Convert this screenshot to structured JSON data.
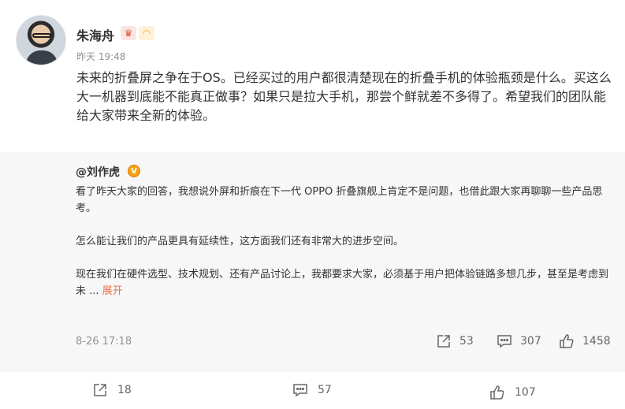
{
  "post": {
    "author": "朱海舟",
    "time": "昨天 19:48",
    "badges": [
      "crown-badge",
      "rainbow-badge"
    ],
    "content": "未来的折叠屏之争在于OS。已经买过的用户都很清楚现在的折叠手机的体验瓶颈是什么。买这么大一机器到底能不能真正做事？如果只是拉大手机，那尝个鲜就差不多得了。希望我们的团队能给大家带来全新的体验。"
  },
  "repost": {
    "author": "@刘作虎",
    "paragraphs": [
      "看了昨天大家的回答，我想说外屏和折痕在下一代 OPPO 折叠旗舰上肯定不是问题，也借此跟大家再聊聊一些产品思考。",
      "怎么能让我们的产品更具有延续性，这方面我们还有非常大的进步空间。",
      "现在我们在硬件选型、技术规划、还有产品讨论上，我都要求大家，必须基于用户把体验链路多想几步，甚至是考虑到未 ..."
    ],
    "expand_label": "展开",
    "time": "8-26 17:18",
    "forward_count": "53",
    "comment_count": "307",
    "like_count": "1458"
  },
  "footer": {
    "forward_count": "18",
    "comment_count": "57",
    "like_count": "107"
  },
  "colors": {
    "accent": "#eb7350",
    "repost_bg": "#f7f7f7",
    "muted": "#939393"
  }
}
